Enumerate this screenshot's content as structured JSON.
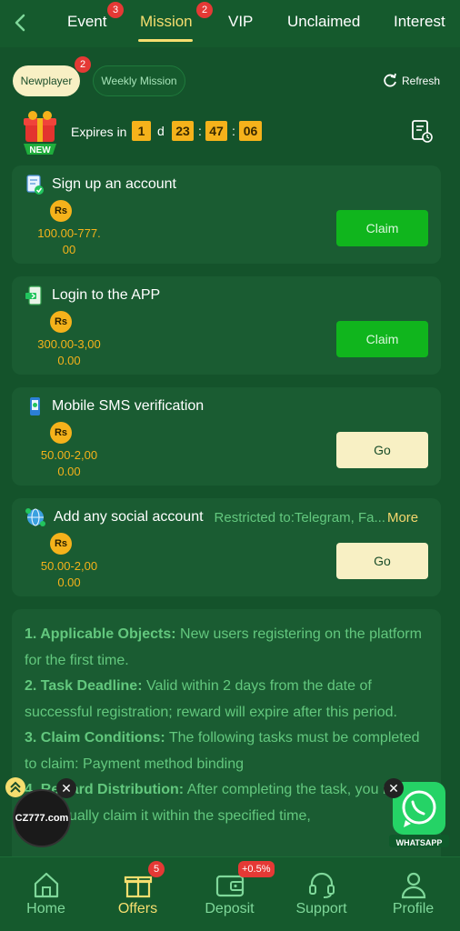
{
  "topnav": {
    "tabs": [
      {
        "label": "Event",
        "badge": "3"
      },
      {
        "label": "Mission",
        "badge": "2",
        "active": true
      },
      {
        "label": "VIP"
      },
      {
        "label": "Unclaimed"
      },
      {
        "label": "Interest"
      }
    ]
  },
  "subtabs": {
    "newplayer": {
      "label": "Newplayer",
      "badge": "2"
    },
    "weekly": {
      "label": "Weekly Mission"
    },
    "refresh": "Refresh"
  },
  "expires": {
    "label": "Expires in",
    "days": "1",
    "day_unit": "d",
    "hours": "23",
    "minutes": "47",
    "seconds": "06",
    "gift_badge": "NEW"
  },
  "tasks": [
    {
      "title": "Sign up an account",
      "currency": "Rs",
      "reward_line1": "100.00-777.",
      "reward_line2": "00",
      "button": "Claim",
      "icon": "document-check-icon"
    },
    {
      "title": "Login to the APP",
      "currency": "Rs",
      "reward_line1": "300.00-3,00",
      "reward_line2": "0.00",
      "button": "Claim",
      "icon": "app-login-icon"
    },
    {
      "title": "Mobile SMS verification",
      "currency": "Rs",
      "reward_line1": "50.00-2,00",
      "reward_line2": "0.00",
      "button": "Go",
      "icon": "phone-sms-icon"
    },
    {
      "title": "Add any social account",
      "restricted": "Restricted to:Telegram, Fa...",
      "more": "More",
      "currency": "Rs",
      "reward_line1": "50.00-2,00",
      "reward_line2": "0.00",
      "button": "Go",
      "icon": "social-globe-icon"
    }
  ],
  "rules": [
    {
      "head": "1. Applicable Objects:",
      "body": " New users registering on the platform for the first time."
    },
    {
      "head": "2. Task Deadline:",
      "body": " Valid within 2 days from the date of successful registration; reward will expire after this period."
    },
    {
      "head": "3. Claim Conditions:",
      "body": " The following tasks must be completed to claim: Payment method binding"
    },
    {
      "head": "4. Reward Distribution:",
      "body": " After completing the task, you need to manually claim it within the specified time,"
    }
  ],
  "floats": {
    "cz_logo": "CZ777.com",
    "whatsapp": "WHATSAPP"
  },
  "bottomnav": {
    "items": [
      {
        "label": "Home"
      },
      {
        "label": "Offers",
        "badge": "5",
        "active": true
      },
      {
        "label": "Deposit",
        "badge": "+0.5%"
      },
      {
        "label": "Support"
      },
      {
        "label": "Profile"
      }
    ]
  },
  "colors": {
    "background": "#14532b",
    "accent_yellow": "#f6de6f",
    "claim_green": "#10b51d",
    "badge_red": "#e53935"
  }
}
